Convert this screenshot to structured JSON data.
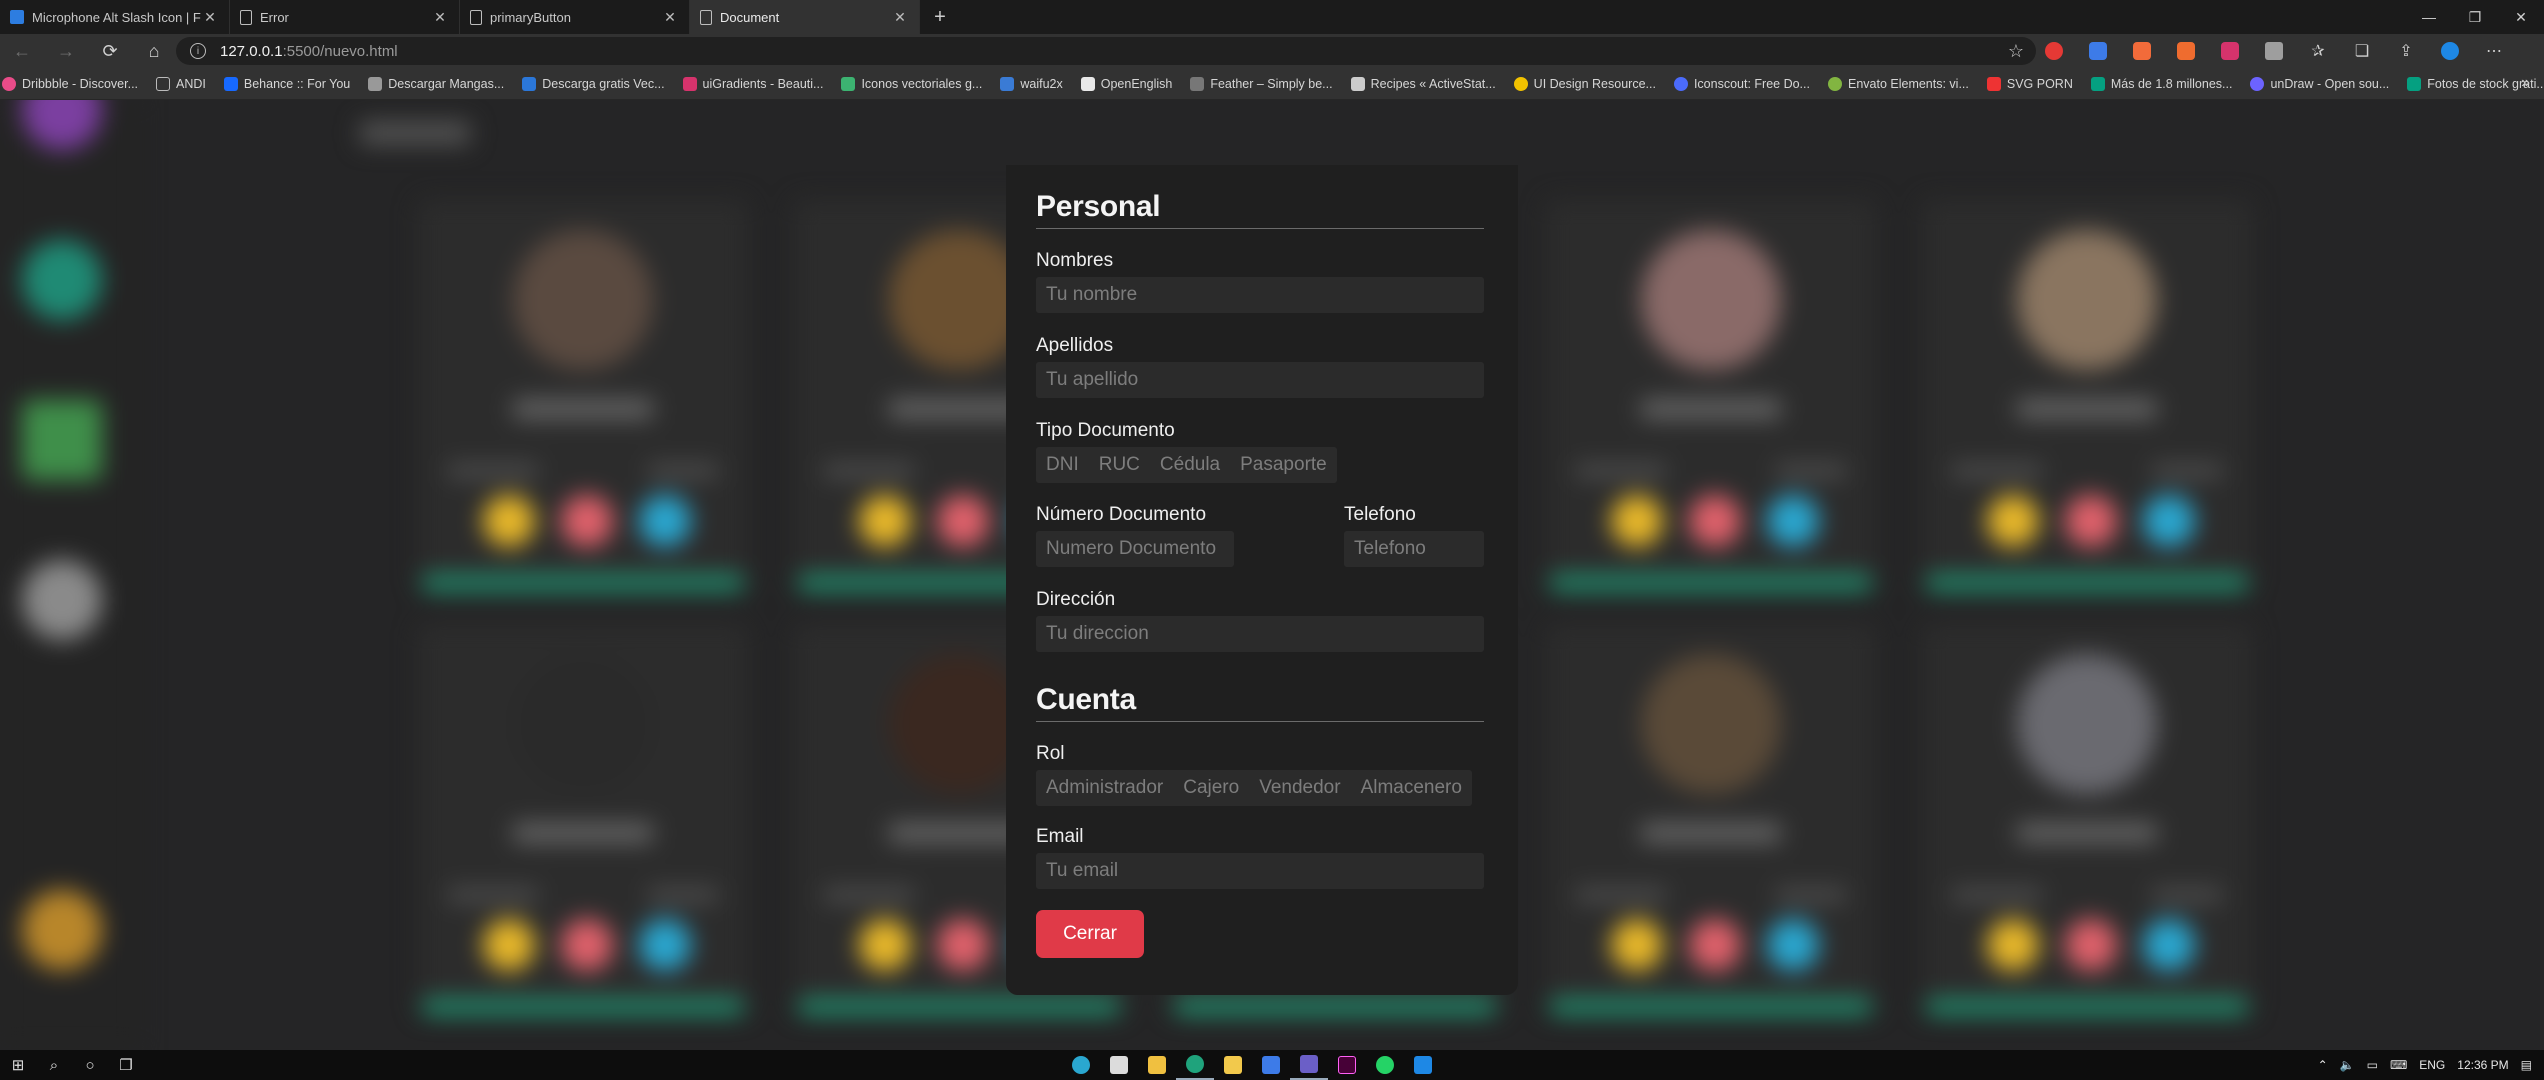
{
  "browser": {
    "tabs": [
      {
        "title": "Microphone Alt Slash Icon | Font Awesome",
        "favicon_color": "#2d7de0",
        "active": false
      },
      {
        "title": "Error",
        "favicon_color": "",
        "active": false
      },
      {
        "title": "primaryButton",
        "favicon_color": "",
        "active": false
      },
      {
        "title": "Document",
        "favicon_color": "",
        "active": true
      }
    ],
    "new_tab": "+",
    "window_controls": {
      "minimize": "—",
      "restore": "❐",
      "close": "✕"
    },
    "url": {
      "host": "127.0.0.1",
      "path": ":5500/nuevo.html"
    },
    "bookmarks": [
      {
        "label": "Dribbble - Discover...",
        "color": "#ea4c89"
      },
      {
        "label": "ANDI",
        "color": "#bbbbbb"
      },
      {
        "label": "Behance :: For You",
        "color": "#1769ff"
      },
      {
        "label": "Descargar Mangas...",
        "color": "#999999"
      },
      {
        "label": "Descarga gratis Vec...",
        "color": "#2b77d9"
      },
      {
        "label": "uiGradients - Beauti...",
        "color": "#d6336c"
      },
      {
        "label": "Iconos vectoriales g...",
        "color": "#3cb371"
      },
      {
        "label": "waifu2x",
        "color": "#3a7bd5"
      },
      {
        "label": "OpenEnglish",
        "color": "#e8e8e8"
      },
      {
        "label": "Feather – Simply be...",
        "color": "#777777"
      },
      {
        "label": "Recipes « ActiveStat...",
        "color": "#cccccc"
      },
      {
        "label": "UI Design Resource...",
        "color": "#f2c200"
      },
      {
        "label": "Iconscout: Free Do...",
        "color": "#4b6bfb"
      },
      {
        "label": "Envato Elements: vi...",
        "color": "#82b541"
      },
      {
        "label": "SVG PORN",
        "color": "#e33"
      },
      {
        "label": "Más de 1.8 millones...",
        "color": "#05a081"
      },
      {
        "label": "unDraw - Open sou...",
        "color": "#6c63ff"
      },
      {
        "label": "Fotos de stock grati...",
        "color": "#05a081"
      }
    ],
    "more_bookmarks": "»"
  },
  "form": {
    "personal_title": "Personal",
    "nombres_label": "Nombres",
    "nombres_placeholder": "Tu nombre",
    "apellidos_label": "Apellidos",
    "apellidos_placeholder": "Tu apellido",
    "tipo_documento_label": "Tipo Documento",
    "tipo_documento_options": [
      "DNI",
      "RUC",
      "Cédula",
      "Pasaporte"
    ],
    "numero_documento_label": "Número Documento",
    "numero_documento_placeholder": "Numero Documento",
    "telefono_label": "Telefono",
    "telefono_placeholder": "Telefono",
    "direccion_label": "Dirección",
    "direccion_placeholder": "Tu direccion",
    "cuenta_title": "Cuenta",
    "rol_label": "Rol",
    "rol_options": [
      "Administrador",
      "Cajero",
      "Vendedor",
      "Almacenero"
    ],
    "email_label": "Email",
    "email_placeholder": "Tu email",
    "close_button": "Cerrar",
    "accent_color": "#e03a48"
  },
  "taskbar": {
    "language": "ENG",
    "time": "12:36 PM"
  }
}
